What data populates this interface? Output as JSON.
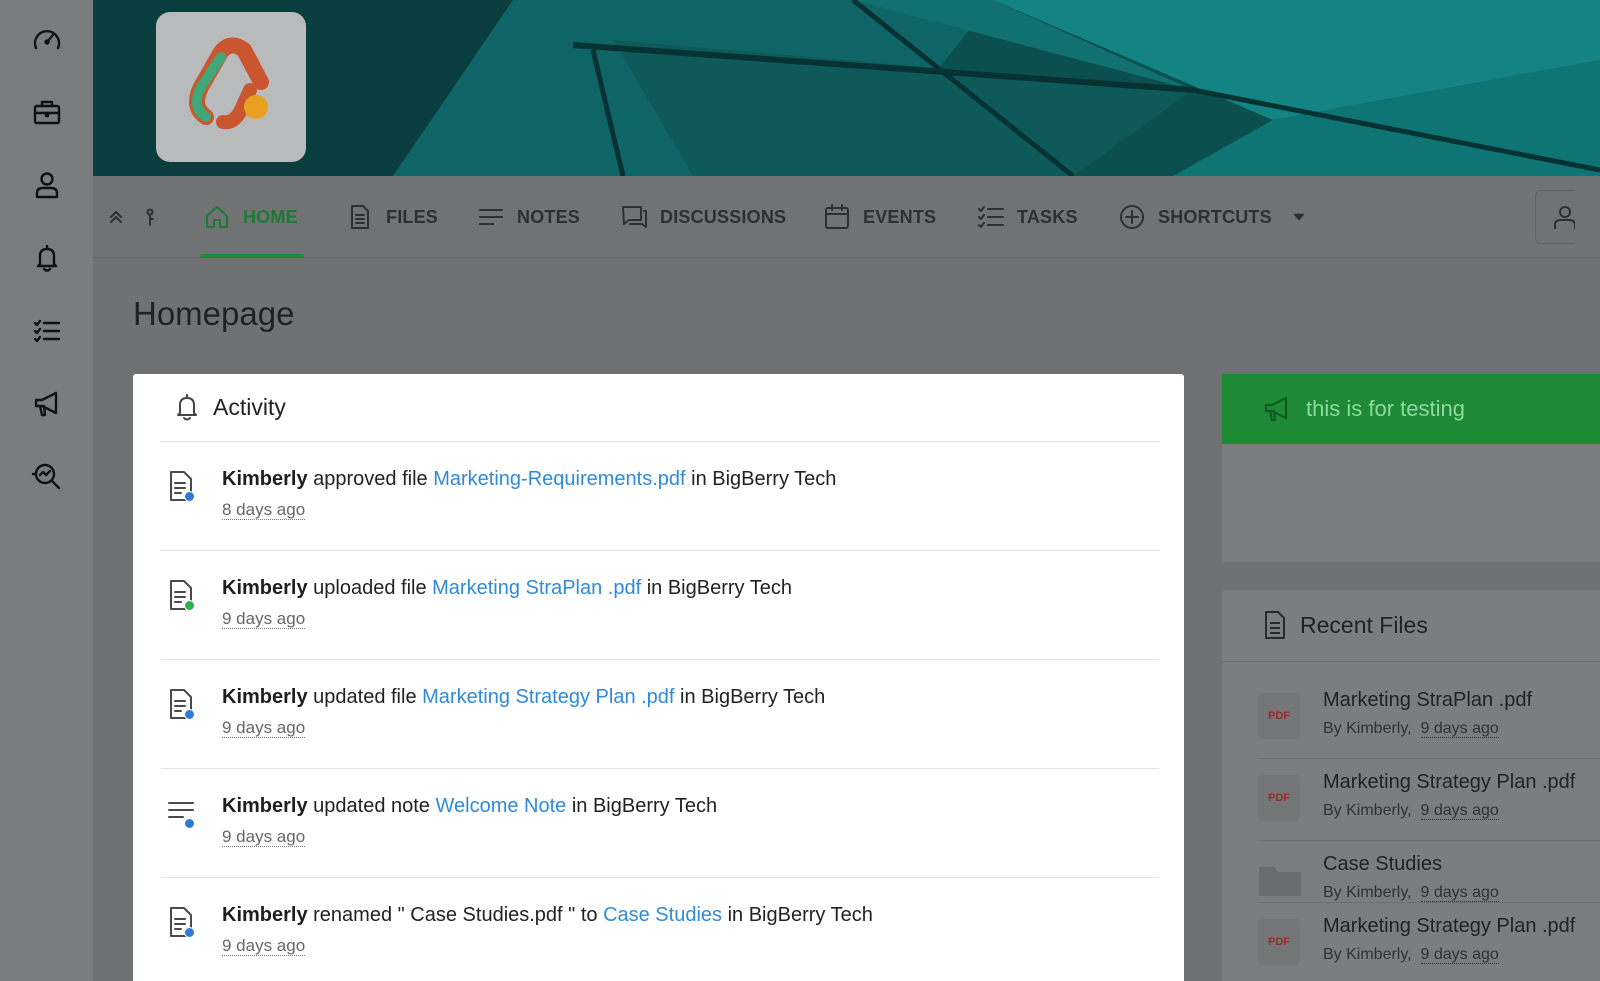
{
  "sidebar": {
    "items": [
      {
        "icon": "speedometer-icon"
      },
      {
        "icon": "briefcase-icon"
      },
      {
        "icon": "user-icon"
      },
      {
        "icon": "bell-icon"
      },
      {
        "icon": "checklist-icon"
      },
      {
        "icon": "megaphone-icon"
      },
      {
        "icon": "search-analytics-icon"
      }
    ]
  },
  "tabs": {
    "home": "HOME",
    "files": "FILES",
    "notes": "NOTES",
    "discussions": "DISCUSSIONS",
    "events": "EVENTS",
    "tasks": "TASKS",
    "shortcuts": "SHORTCUTS"
  },
  "page": {
    "title": "Homepage"
  },
  "activity": {
    "title": "Activity",
    "items": [
      {
        "user": "Kimberly",
        "pre": " approved file ",
        "link": "Marketing-Requirements.pdf",
        "post": " in BigBerry Tech",
        "time": "8 days ago"
      },
      {
        "user": "Kimberly",
        "pre": " uploaded file ",
        "link": "Marketing StraPlan .pdf",
        "post": " in BigBerry Tech",
        "time": "9 days ago"
      },
      {
        "user": "Kimberly",
        "pre": " updated file ",
        "link": "Marketing Strategy Plan .pdf",
        "post": " in BigBerry Tech",
        "time": "9 days ago"
      },
      {
        "user": "Kimberly",
        "pre": " updated note ",
        "link": "Welcome Note",
        "post": " in BigBerry Tech",
        "time": "9 days ago"
      },
      {
        "user": "Kimberly",
        "pre": " renamed \" Case Studies.pdf \" to ",
        "link": "Case Studies",
        "post": " in BigBerry Tech",
        "time": "9 days ago"
      }
    ]
  },
  "announcement": {
    "text": "this is for testing"
  },
  "recent_files": {
    "title": "Recent Files",
    "files": [
      {
        "name": "Marketing StraPlan .pdf",
        "by": "By Kimberly,",
        "time": "9 days ago",
        "type": "PDF"
      },
      {
        "name": "Marketing Strategy Plan .pdf",
        "by": "By Kimberly,",
        "time": "9 days ago",
        "type": "PDF"
      },
      {
        "name": "Case Studies",
        "by": "By Kimberly,",
        "time": "9 days ago",
        "type": "folder"
      },
      {
        "name": "Marketing Strategy Plan .pdf",
        "by": "By Kimberly,",
        "time": "9 days ago",
        "type": "PDF"
      }
    ]
  },
  "colors": {
    "accent_green": "#1e8a35",
    "link_blue": "#2e8bd9",
    "banner_teal": "#0d4a4a"
  }
}
